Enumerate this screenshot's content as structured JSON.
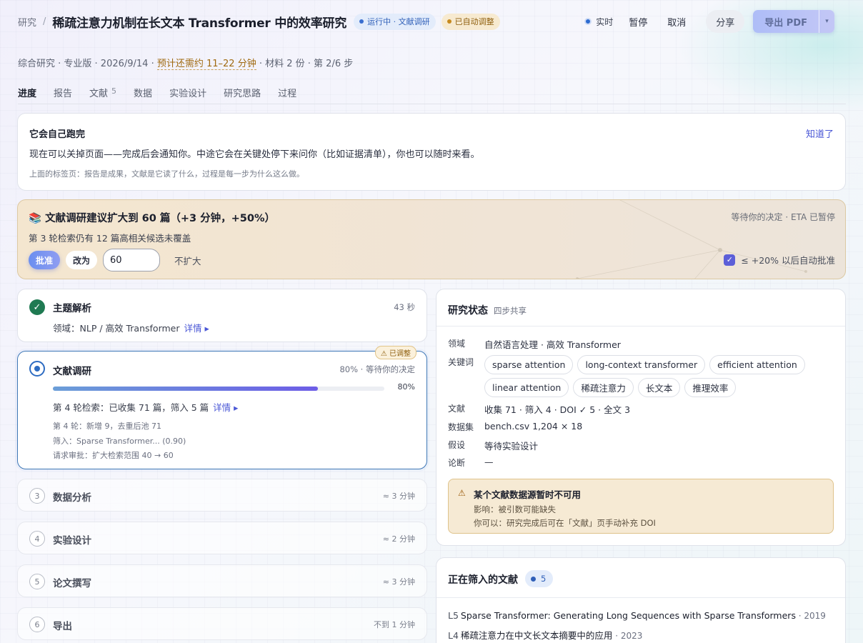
{
  "header": {
    "breadcrumb": "研究",
    "title": "稀疏注意力机制在长文本 Transformer 中的效率研究",
    "status_pill": "运行中 · 文献调研",
    "adjusted_pill": "已自动调整",
    "live_label": "实时",
    "pause_label": "暂停",
    "cancel_label": "取消",
    "share_label": "分享",
    "export_label": "导出 PDF",
    "export_caret": "▾"
  },
  "meta": {
    "prefix": "综合研究 · 专业版 · 2026/9/14 · ",
    "eta": "预计还需约 11–22 分钟",
    "suffix": " · 材料 2 份 · 第 2/6 步"
  },
  "tabs": [
    {
      "label": "进度",
      "count": ""
    },
    {
      "label": "报告",
      "count": ""
    },
    {
      "label": "文献",
      "count": "5"
    },
    {
      "label": "数据",
      "count": ""
    },
    {
      "label": "实验设计",
      "count": ""
    },
    {
      "label": "研究思路",
      "count": ""
    },
    {
      "label": "过程",
      "count": ""
    }
  ],
  "notice": {
    "title": "它会自己跑完",
    "dismiss": "知道了",
    "line1": "现在可以关掉页面——完成后会通知你。中途它会在关键处停下来问你（比如证据清单），你也可以随时来看。",
    "line2": "上面的标签页：报告是成果，文献是它读了什么，过程是每一步为什么这么做。"
  },
  "approval": {
    "title": "📚 文献调研建议扩大到 60 篇（+3 分钟，+50%）",
    "subtitle": "第 3 轮检索仍有 12 篇高相关候选未覆盖",
    "waiting": "等待你的决定 · ETA 已暂停",
    "approve": "批准",
    "change": "改为",
    "amount_value": "60",
    "decline": "不扩大",
    "auto_check": "✓",
    "auto_label": "≤ +20% 以后自动批准"
  },
  "steps": {
    "s1": {
      "title": "主题解析",
      "time": "43 秒",
      "desc": "领域：NLP / 高效 Transformer",
      "details": "详情 ▸",
      "check": "✓"
    },
    "s2": {
      "badge": "⚠ 已调整",
      "title": "文献调研",
      "status": "80% · 等待你的决定",
      "progress": 0.8,
      "progress_label": "80%",
      "desc": "第 4 轮检索：已收集 71 篇，筛入 5 篇",
      "details": "详情 ▸",
      "log1": "第 4 轮：新增 9，去重后池 71",
      "log2": "筛入：Sparse Transformer... (0.90)",
      "log3": "请求审批：扩大检索范围 40 → 60"
    },
    "pending": [
      {
        "num": "3",
        "title": "数据分析",
        "eta": "≈ 3 分钟"
      },
      {
        "num": "4",
        "title": "实验设计",
        "eta": "≈ 2 分钟"
      },
      {
        "num": "5",
        "title": "论文撰写",
        "eta": "≈ 3 分钟"
      },
      {
        "num": "6",
        "title": "导出",
        "eta": "不到 1 分钟"
      }
    ]
  },
  "status": {
    "title": "研究状态",
    "subtitle": "四步共享",
    "domain_key": "领域",
    "domain_val": "自然语言处理 · 高效 Transformer",
    "keywords_key": "关键词",
    "keywords": [
      "sparse attention",
      "long-context transformer",
      "efficient attention",
      "linear attention",
      "稀疏注意力",
      "长文本",
      "推理效率"
    ],
    "lit_key": "文献",
    "lit_val": "收集 71 · 筛入 4 · DOI ✓ 5 · 全文 3",
    "dataset_key": "数据集",
    "dataset_val": "bench.csv 1,204 × 18",
    "hypo_key": "假设",
    "hypo_val": "等待实验设计",
    "thesis_key": "论断",
    "thesis_val": "—",
    "warn_icon": "⚠",
    "warn_title": "某个文献数据源暂时不可用",
    "warn_l1": "影响：被引数可能缺失",
    "warn_l2": "你可以：研究完成后可在「文献」页手动补充 DOI"
  },
  "literature": {
    "title": "正在筛入的文献",
    "count": "5",
    "items": [
      {
        "level": "L5",
        "title": "Sparse Transformer: Generating Long Sequences with Sparse Transformers",
        "year": " · 2019"
      },
      {
        "level": "L4",
        "title": "稀疏注意力在中文长文本摘要中的应用",
        "year": " · 2023"
      }
    ]
  }
}
